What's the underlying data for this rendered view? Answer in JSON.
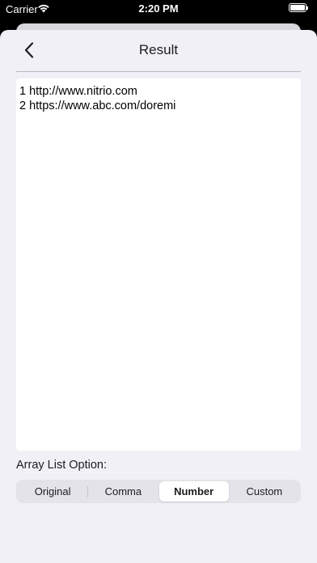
{
  "status_bar": {
    "carrier": "Carrier",
    "time": "2:20 PM",
    "wifi_icon": "wifi-icon",
    "battery_icon": "battery-icon"
  },
  "nav": {
    "back_icon": "chevron-left-icon",
    "title": "Result"
  },
  "result": {
    "lines": [
      "1 http://www.nitrio.com",
      "2 https://www.abc.com/doremi"
    ]
  },
  "options": {
    "label": "Array List Option:",
    "segments": [
      "Original",
      "Comma",
      "Number",
      "Custom"
    ],
    "selected": "Number"
  },
  "colors": {
    "sheet_background": "#f1f0f6",
    "segment_selected": "#ffffff",
    "segment_track": "#e4e3e9"
  }
}
